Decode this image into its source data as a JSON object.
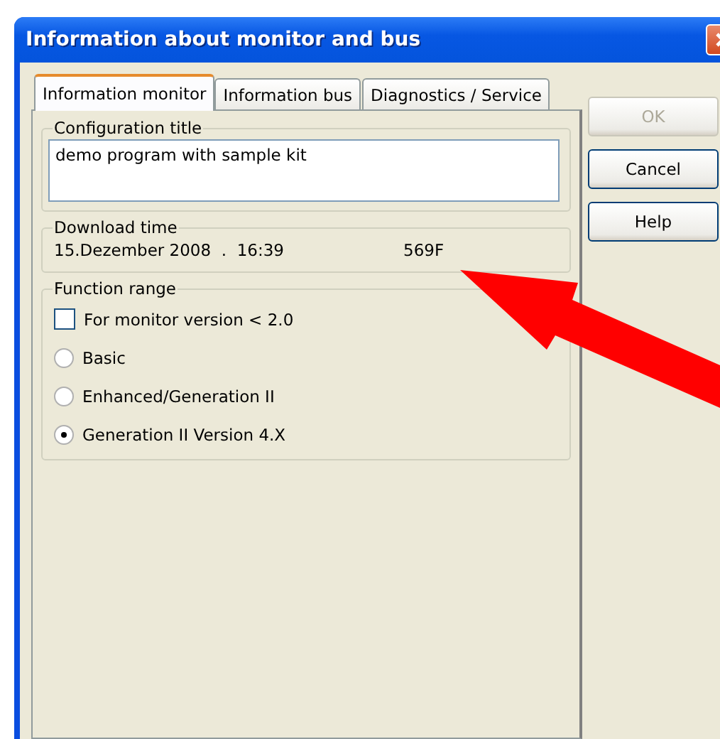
{
  "window": {
    "title": "Information about monitor and bus"
  },
  "tabs": [
    {
      "label": "Information monitor",
      "selected": true
    },
    {
      "label": "Information bus",
      "selected": false
    },
    {
      "label": "Diagnostics / Service",
      "selected": false
    }
  ],
  "configuration": {
    "legend": "Configuration title",
    "value": "demo program with sample kit"
  },
  "download": {
    "legend": "Download time",
    "date": "15.Dezember 2008  .  16:39",
    "code": "569F"
  },
  "function_range": {
    "legend": "Function range",
    "options": [
      {
        "kind": "checkbox",
        "label": "For monitor version < 2.0",
        "checked": false
      },
      {
        "kind": "radio",
        "label": "Basic",
        "selected": false
      },
      {
        "kind": "radio",
        "label": "Enhanced/Generation II",
        "selected": false
      },
      {
        "kind": "radio",
        "label": "Generation II Version 4.X",
        "selected": true
      }
    ]
  },
  "buttons": [
    {
      "label": "OK",
      "disabled": true
    },
    {
      "label": "Cancel",
      "disabled": false
    },
    {
      "label": "Help",
      "disabled": false
    }
  ]
}
